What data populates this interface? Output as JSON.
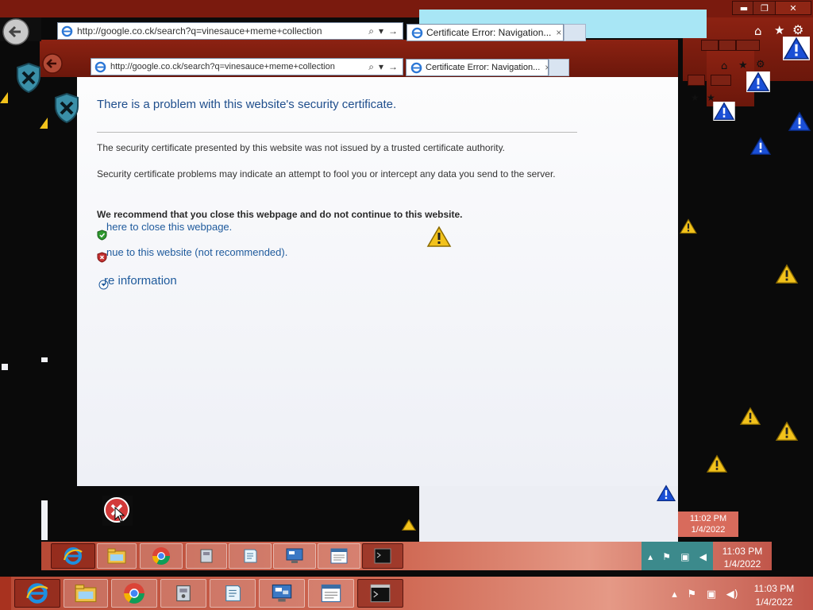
{
  "browser": {
    "address_url": "http://google.co.ck/search?q=vinesauce+meme+collection",
    "tab_title": "Certificate Error: Navigation...",
    "tab_close": "×"
  },
  "window_controls": {
    "minimize": "▬",
    "restore": "❐",
    "close": "✕"
  },
  "cert_error": {
    "heading": "There is a problem with this website's security certificate.",
    "para1": "The security certificate presented by this website was not issued by a trusted certificate authority.",
    "para2": "Security certificate problems may indicate an attempt to fool you or intercept any data you send to the server.",
    "recommendation": "We recommend that you close this webpage and do not continue to this website.",
    "close_link": "here to close this webpage.",
    "continue_link": "nue to this website (not recommended).",
    "more_info": "re information"
  },
  "taskbar": {
    "apps": [
      "internet-explorer",
      "file-explorer",
      "chrome",
      "control-panel",
      "notepad",
      "remote-desktop",
      "windows-journal",
      "command-prompt"
    ],
    "clock_time": "11:03 PM",
    "clock_date": "1/4/2022",
    "ghost_clock_time": "11:02 PM",
    "ghost_clock_date": "1/4/2022"
  },
  "colors": {
    "taskbar": "#c9604c",
    "link": "#1e5a9c",
    "heading": "#1f4e8c",
    "warning_yellow": "#f2c21b",
    "warning_blue": "#1a4fd6"
  }
}
